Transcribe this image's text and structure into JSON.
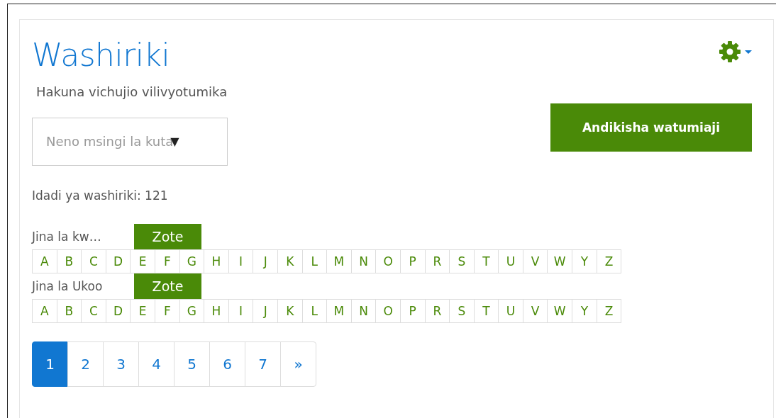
{
  "title": "Washiriki",
  "filters_note": "Hakuna vichujio vilivyotumika",
  "keyword_select": {
    "placeholder": "Neno msingi la kuta",
    "caret": "▼"
  },
  "enrol_button": "Andikisha watumiaji",
  "participant_count": "Idadi ya washiriki: 121",
  "initials_bars": [
    {
      "label": "Jina la kw…",
      "all": {
        "label": "Zote",
        "selected": true
      },
      "letters": [
        "A",
        "B",
        "C",
        "D",
        "E",
        "F",
        "G",
        "H",
        "I",
        "J",
        "K",
        "L",
        "M",
        "N",
        "O",
        "P",
        "R",
        "S",
        "T",
        "U",
        "V",
        "W",
        "Y",
        "Z"
      ]
    },
    {
      "label": "Jina la Ukoo",
      "all": {
        "label": "Zote",
        "selected": true
      },
      "letters": [
        "A",
        "B",
        "C",
        "D",
        "E",
        "F",
        "G",
        "H",
        "I",
        "J",
        "K",
        "L",
        "M",
        "N",
        "O",
        "P",
        "R",
        "S",
        "T",
        "U",
        "V",
        "W",
        "Y",
        "Z"
      ]
    }
  ],
  "pagination": [
    {
      "label": "1",
      "selected": true
    },
    {
      "label": "2",
      "selected": false
    },
    {
      "label": "3",
      "selected": false
    },
    {
      "label": "4",
      "selected": false
    },
    {
      "label": "5",
      "selected": false
    },
    {
      "label": "6",
      "selected": false
    },
    {
      "label": "7",
      "selected": false
    },
    {
      "label": "»",
      "selected": false
    }
  ]
}
